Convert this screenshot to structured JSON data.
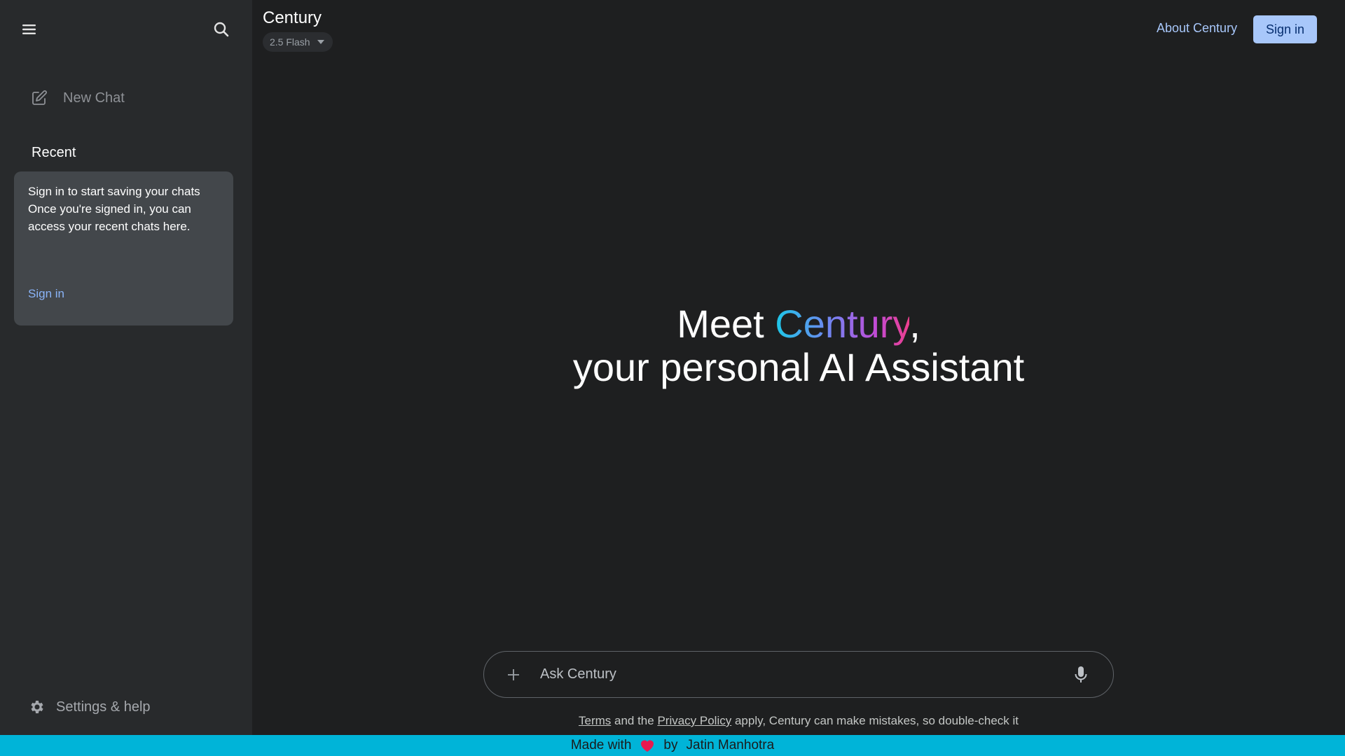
{
  "sidebar": {
    "new_chat_label": "New Chat",
    "recent_label": "Recent",
    "signin_card": {
      "line1": "Sign in to start saving your chats",
      "line2": "Once you're signed in, you can access your recent chats here.",
      "link_label": "Sign in"
    },
    "settings_label": "Settings & help"
  },
  "header": {
    "app_title": "Century",
    "model_selected": "2.5 Flash",
    "about_label": "About Century",
    "signin_label": "Sign in"
  },
  "hero": {
    "prefix": "Meet ",
    "brand": "Century",
    "suffix": ",",
    "line2": "your personal AI Assistant"
  },
  "input": {
    "placeholder": "Ask Century",
    "value": ""
  },
  "disclaimer": {
    "terms": "Terms",
    "and_the": " and the ",
    "privacy": "Privacy Policy",
    "rest": " apply, Century can make mistakes, so double-check it"
  },
  "footer": {
    "made_with": "Made with",
    "by": "by",
    "author": "Jatin Manhotra"
  },
  "colors": {
    "background": "#1e1f20",
    "sidebar": "#282a2c",
    "accent": "#a8c7fa",
    "link": "#8ab4f8",
    "footer": "#00b4d8",
    "heart": "#e8194f"
  },
  "icons": {
    "menu": "hamburger-menu-icon",
    "search": "search-icon",
    "new_chat": "edit-pencil-icon",
    "settings": "gear-icon",
    "model_dropdown": "caret-down-icon",
    "attach": "plus-icon",
    "mic": "microphone-icon",
    "heart": "heart-icon"
  }
}
